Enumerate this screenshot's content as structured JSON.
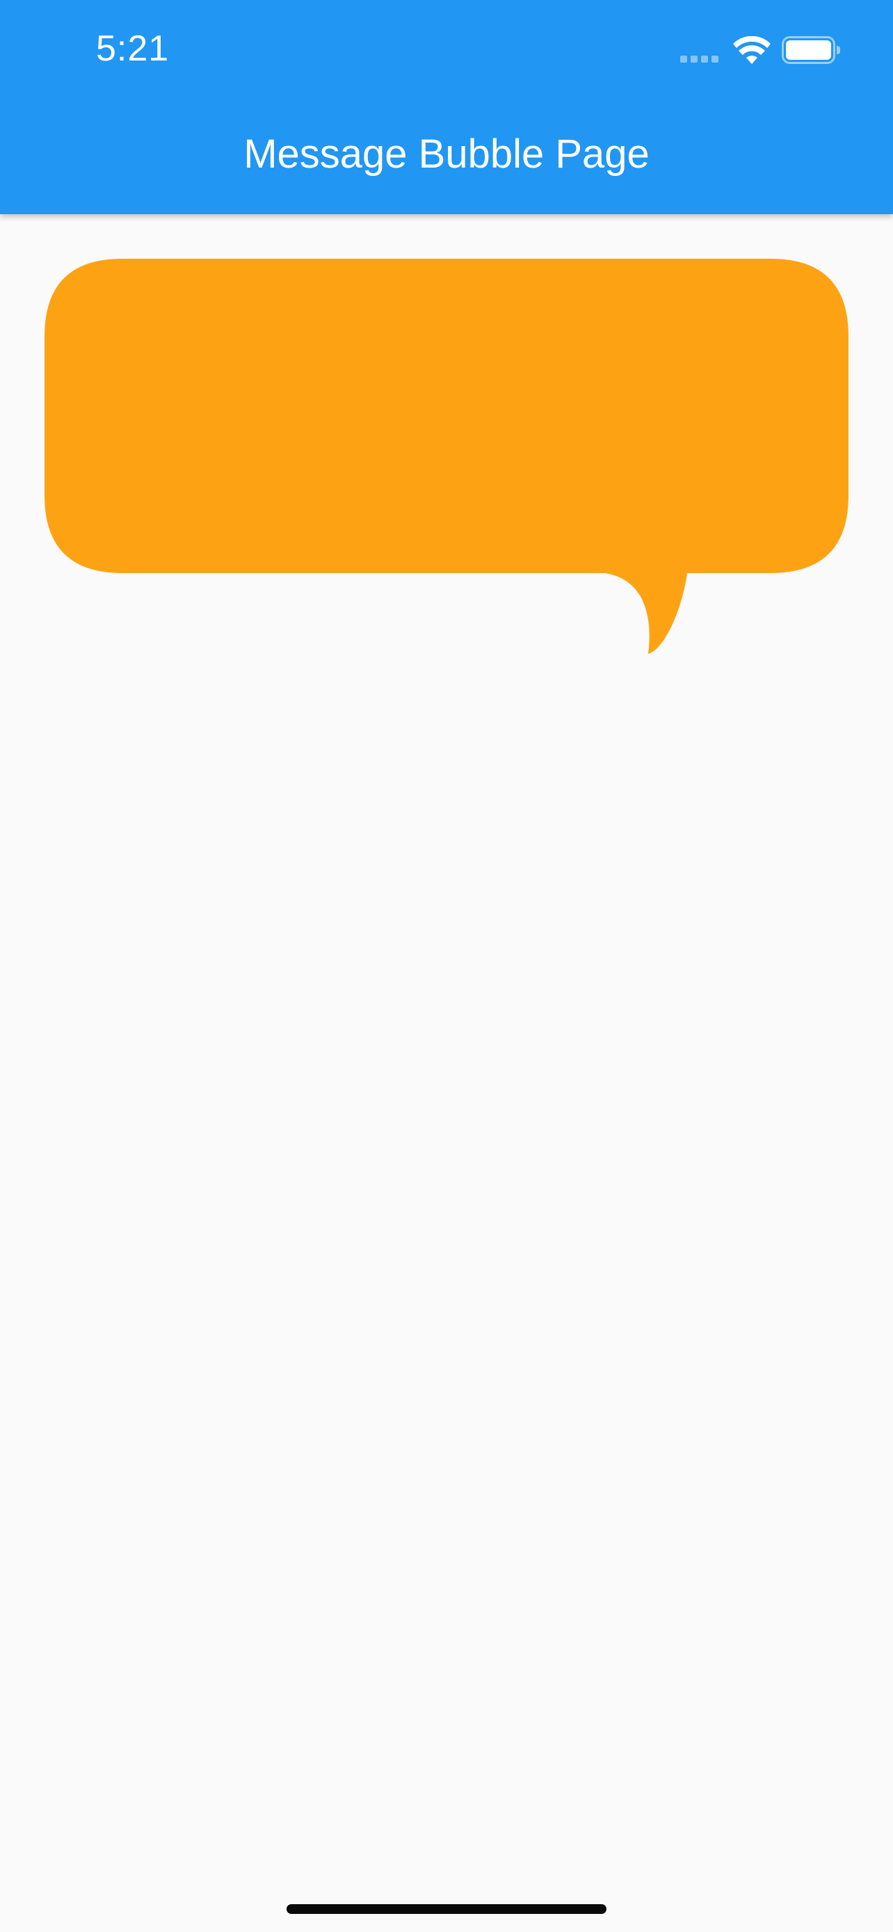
{
  "status_bar": {
    "time": "5:21",
    "icons": [
      "signal-icon",
      "wifi-icon",
      "battery-icon"
    ]
  },
  "app_bar": {
    "title": "Message Bubble Page"
  },
  "bubble": {
    "text": ""
  },
  "colors": {
    "app_bar": "#2196F3",
    "bubble": "#FDA313",
    "background": "#FAFAFA",
    "home_indicator": "#0A0A0A"
  }
}
